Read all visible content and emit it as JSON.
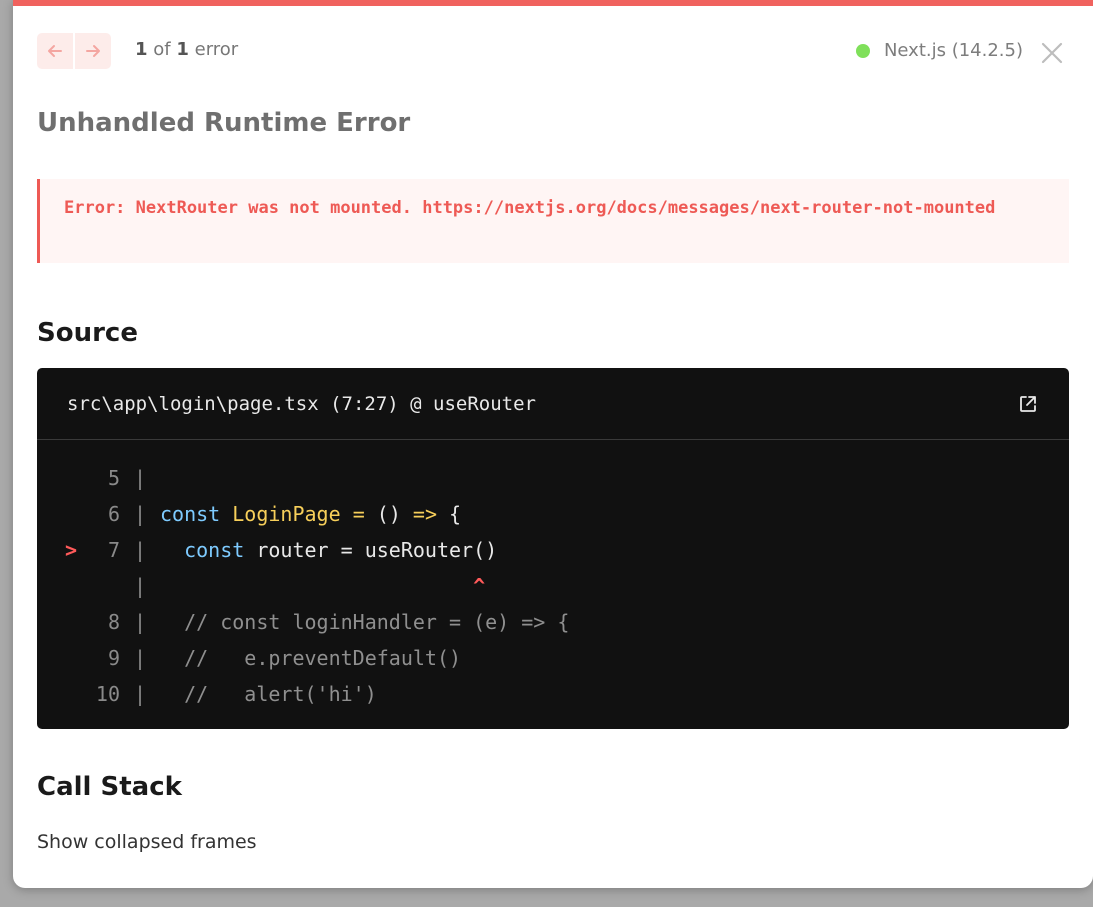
{
  "pagination": {
    "current": "1",
    "of_text": "of",
    "total": "1",
    "unit": "error",
    "prev_icon": "arrow-left-icon",
    "next_icon": "arrow-right-icon"
  },
  "framework": {
    "label": "Next.js (14.2.5)",
    "status_color": "#7fe05a"
  },
  "heading": "Unhandled Runtime Error",
  "error_message": "Error: NextRouter was not mounted. https://nextjs.org/docs/messages/next-router-not-mounted",
  "source": {
    "title": "Source",
    "file_location": "src\\app\\login\\page.tsx (7:27) @ useRouter",
    "open_icon": "external-link-icon",
    "lines": [
      {
        "marker": "",
        "num": "5",
        "pipe": "|",
        "tokens": []
      },
      {
        "marker": "",
        "num": "6",
        "pipe": "|",
        "tokens": [
          {
            "t": "kw",
            "v": "const"
          },
          {
            "t": "code",
            "v": " "
          },
          {
            "t": "fn",
            "v": "LoginPage"
          },
          {
            "t": "code",
            "v": " "
          },
          {
            "t": "op",
            "v": "="
          },
          {
            "t": "code",
            "v": " () "
          },
          {
            "t": "op",
            "v": "=>"
          },
          {
            "t": "code",
            "v": " {"
          }
        ]
      },
      {
        "marker": ">",
        "num": "7",
        "pipe": "|",
        "tokens": [
          {
            "t": "code",
            "v": "  "
          },
          {
            "t": "kw",
            "v": "const"
          },
          {
            "t": "code",
            "v": " router = useRouter()"
          }
        ]
      },
      {
        "marker": "",
        "num": "",
        "pipe": "|",
        "tokens": [
          {
            "t": "code",
            "v": "                          "
          },
          {
            "t": "caret",
            "v": "^"
          }
        ]
      },
      {
        "marker": "",
        "num": "8",
        "pipe": "|",
        "tokens": [
          {
            "t": "cmt",
            "v": "  // const loginHandler = (e) => {"
          }
        ]
      },
      {
        "marker": "",
        "num": "9",
        "pipe": "|",
        "tokens": [
          {
            "t": "cmt",
            "v": "  //   e.preventDefault()"
          }
        ]
      },
      {
        "marker": "",
        "num": "10",
        "pipe": "|",
        "tokens": [
          {
            "t": "cmt",
            "v": "  //   alert('hi')"
          }
        ]
      }
    ]
  },
  "call_stack": {
    "title": "Call Stack",
    "toggle_label": "Show collapsed frames"
  },
  "colors": {
    "accent": "#f0625e",
    "error_text": "#ee5a55"
  }
}
